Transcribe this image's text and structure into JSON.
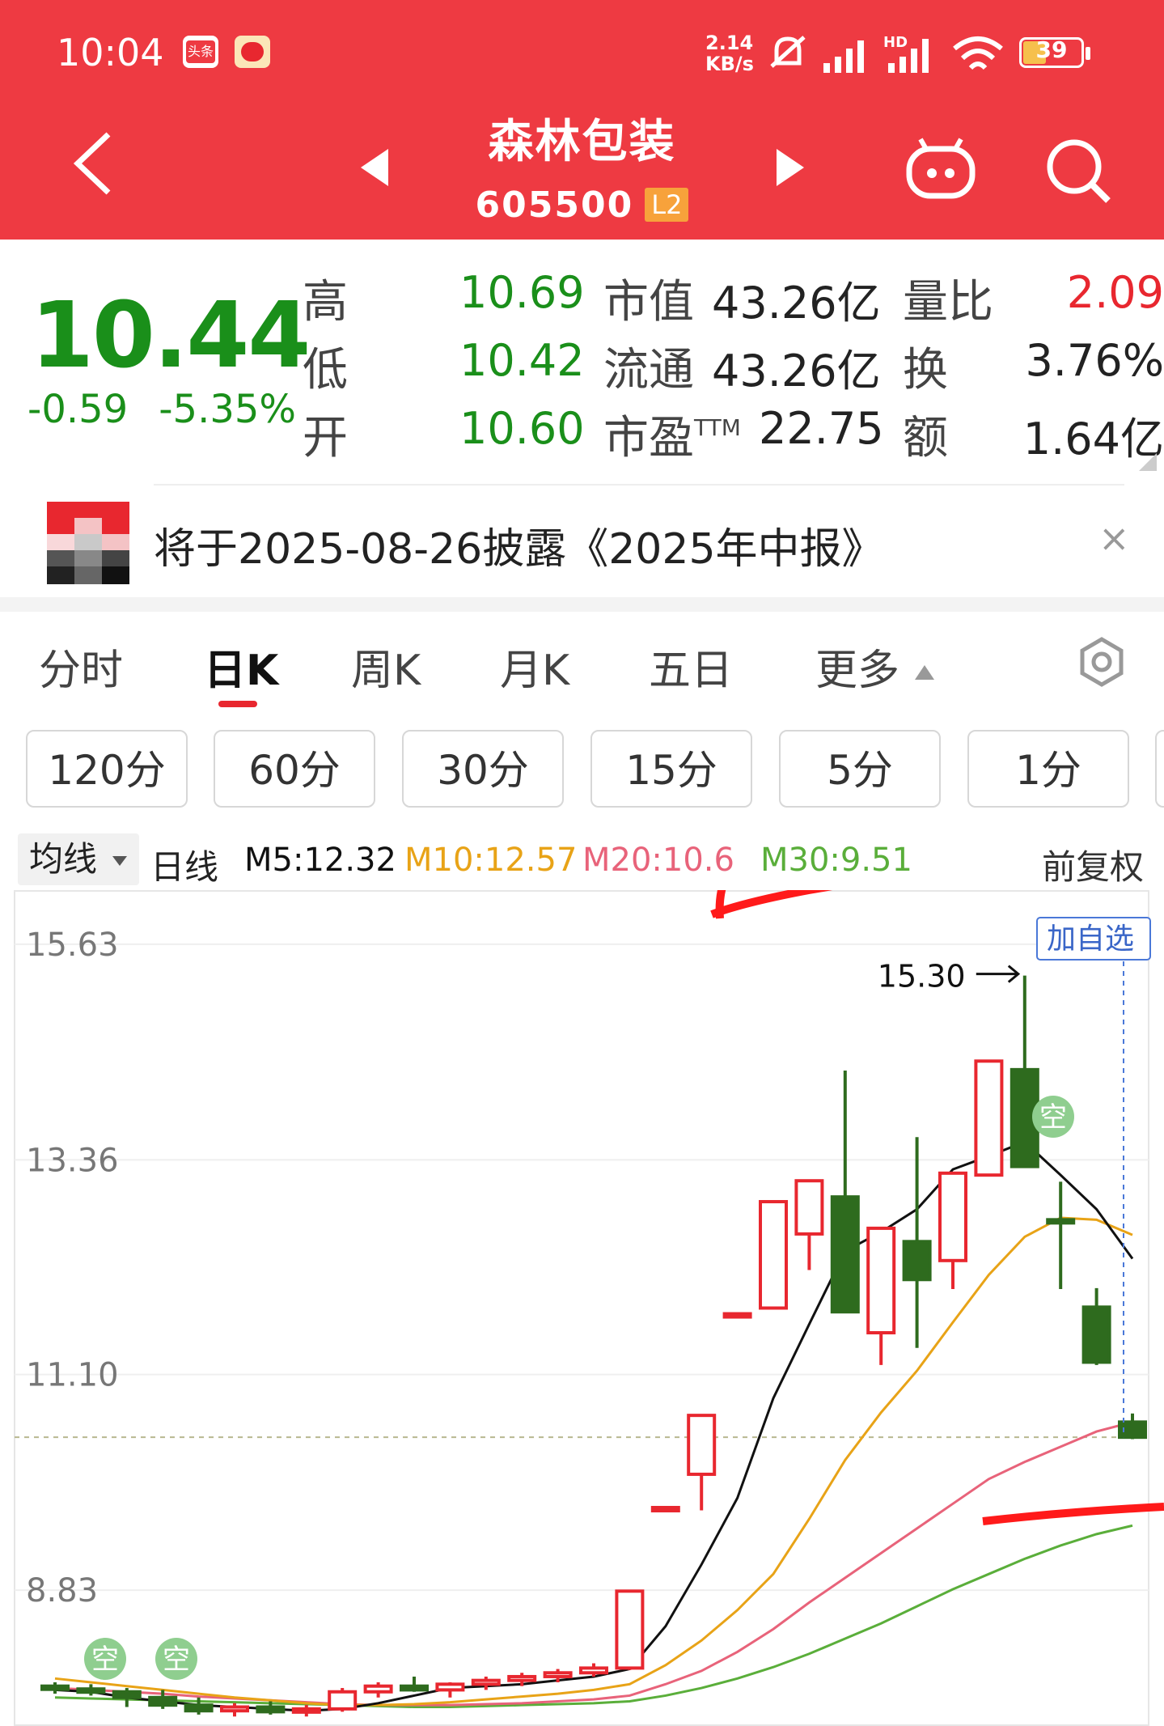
{
  "status_bar": {
    "time": "10:04",
    "net_speed": "2.14\nKB/s",
    "battery": "39",
    "icons": [
      "toutiao-app-icon",
      "red-app-icon",
      "mute-icon",
      "signal-icon",
      "hd-signal-icon",
      "wifi-icon",
      "battery-icon"
    ]
  },
  "header": {
    "title": "森林包装",
    "code": "605500",
    "level": "L2",
    "icons": [
      "back-icon",
      "prev-stock-icon",
      "next-stock-icon",
      "robot-icon",
      "search-icon"
    ]
  },
  "quote": {
    "price": "10.44",
    "change": "-0.59",
    "change_pct": "-5.35%",
    "fields": [
      {
        "label": "高",
        "value": "10.69"
      },
      {
        "label": "低",
        "value": "10.42"
      },
      {
        "label": "开",
        "value": "10.60"
      }
    ],
    "stats": [
      {
        "label": "市值",
        "sup": "",
        "value": "43.26亿"
      },
      {
        "label": "流通",
        "sup": "",
        "value": "43.26亿"
      },
      {
        "label": "市盈",
        "sup": "TTM",
        "value": "22.75"
      }
    ],
    "stats2": [
      {
        "label": "量比",
        "value": "2.09"
      },
      {
        "label": "换",
        "value": "3.76%"
      },
      {
        "label": "额",
        "value": "1.64亿"
      }
    ]
  },
  "announcement": {
    "text": "将于2025-08-26披露《2025年中报》",
    "close": "×"
  },
  "tabs": [
    "分时",
    "日K",
    "周K",
    "月K",
    "五日",
    "更多"
  ],
  "active_tab": "日K",
  "periods": [
    "120分",
    "60分",
    "30分",
    "15分",
    "5分",
    "1分"
  ],
  "ma_bar": {
    "selector": "均线",
    "period": "日线",
    "m5": "M5:12.32",
    "m10": "M10:12.57",
    "m20": "M20:10.6",
    "m30": "M30:9.51",
    "adjust": "前复权",
    "colors": {
      "m5": "#111111",
      "m10": "#e8a317",
      "m20": "#e8637a",
      "m30": "#5aae3a"
    }
  },
  "chart_data": {
    "type": "candlestick",
    "y_ticks": [
      "15.63",
      "13.36",
      "11.10",
      "8.83"
    ],
    "ylim": [
      7.4,
      16.2
    ],
    "high_annotation": "15.30",
    "current_price": 10.44,
    "add_watchlist": "加自选",
    "badges": [
      "空",
      "空",
      "空"
    ],
    "up_color": "#e8272f",
    "down_color": "#2e6b1e",
    "candles": [
      {
        "o": 7.82,
        "h": 7.86,
        "l": 7.74,
        "c": 7.79
      },
      {
        "o": 7.79,
        "h": 7.84,
        "l": 7.72,
        "c": 7.76
      },
      {
        "o": 7.76,
        "h": 7.8,
        "l": 7.6,
        "c": 7.7
      },
      {
        "o": 7.7,
        "h": 7.78,
        "l": 7.58,
        "c": 7.62
      },
      {
        "o": 7.62,
        "h": 7.7,
        "l": 7.52,
        "c": 7.56
      },
      {
        "o": 7.56,
        "h": 7.64,
        "l": 7.5,
        "c": 7.6
      },
      {
        "o": 7.6,
        "h": 7.66,
        "l": 7.52,
        "c": 7.55
      },
      {
        "o": 7.55,
        "h": 7.62,
        "l": 7.5,
        "c": 7.58
      },
      {
        "o": 7.58,
        "h": 7.8,
        "l": 7.55,
        "c": 7.76
      },
      {
        "o": 7.76,
        "h": 7.86,
        "l": 7.7,
        "c": 7.82
      },
      {
        "o": 7.82,
        "h": 7.92,
        "l": 7.76,
        "c": 7.78
      },
      {
        "o": 7.78,
        "h": 7.86,
        "l": 7.7,
        "c": 7.84
      },
      {
        "o": 7.84,
        "h": 7.92,
        "l": 7.78,
        "c": 7.88
      },
      {
        "o": 7.88,
        "h": 7.96,
        "l": 7.82,
        "c": 7.92
      },
      {
        "o": 7.92,
        "h": 8.0,
        "l": 7.86,
        "c": 7.96
      },
      {
        "o": 7.96,
        "h": 8.06,
        "l": 7.92,
        "c": 8.01
      },
      {
        "o": 8.01,
        "h": 8.82,
        "l": 7.99,
        "c": 8.82
      },
      {
        "o": 9.7,
        "h": 9.7,
        "l": 9.7,
        "c": 9.7
      },
      {
        "o": 10.05,
        "h": 10.67,
        "l": 9.67,
        "c": 10.67
      },
      {
        "o": 11.74,
        "h": 11.74,
        "l": 11.74,
        "c": 11.74
      },
      {
        "o": 11.8,
        "h": 12.92,
        "l": 11.8,
        "c": 12.92
      },
      {
        "o": 12.58,
        "h": 13.14,
        "l": 12.2,
        "c": 13.14
      },
      {
        "o": 12.97,
        "h": 14.3,
        "l": 11.76,
        "c": 11.76
      },
      {
        "o": 11.54,
        "h": 12.64,
        "l": 11.2,
        "c": 12.64
      },
      {
        "o": 12.5,
        "h": 13.6,
        "l": 11.38,
        "c": 12.1
      },
      {
        "o": 12.3,
        "h": 13.22,
        "l": 12.0,
        "c": 13.22
      },
      {
        "o": 13.2,
        "h": 14.4,
        "l": 13.2,
        "c": 14.4
      },
      {
        "o": 14.31,
        "h": 15.3,
        "l": 13.29,
        "c": 13.29
      },
      {
        "o": 12.73,
        "h": 13.13,
        "l": 12.0,
        "c": 12.7
      },
      {
        "o": 11.81,
        "h": 12.01,
        "l": 11.2,
        "c": 11.23
      },
      {
        "o": 10.6,
        "h": 10.69,
        "l": 10.42,
        "c": 10.44
      }
    ],
    "ma5": [
      7.78,
      7.76,
      7.7,
      7.66,
      7.62,
      7.6,
      7.58,
      7.56,
      7.58,
      7.64,
      7.72,
      7.8,
      7.82,
      7.84,
      7.88,
      7.92,
      8.0,
      8.45,
      9.1,
      9.8,
      10.85,
      11.63,
      12.4,
      12.6,
      12.84,
      13.26,
      13.4,
      13.55,
      13.2,
      12.84,
      12.32
    ],
    "ma10": [
      7.9,
      7.86,
      7.82,
      7.78,
      7.74,
      7.7,
      7.67,
      7.64,
      7.62,
      7.62,
      7.63,
      7.65,
      7.68,
      7.71,
      7.74,
      7.78,
      7.84,
      8.04,
      8.3,
      8.62,
      9.0,
      9.58,
      10.2,
      10.7,
      11.14,
      11.65,
      12.15,
      12.55,
      12.75,
      12.73,
      12.57
    ],
    "ma20": [
      7.8,
      7.78,
      7.76,
      7.74,
      7.71,
      7.69,
      7.67,
      7.65,
      7.63,
      7.62,
      7.62,
      7.62,
      7.63,
      7.64,
      7.66,
      7.68,
      7.72,
      7.84,
      7.98,
      8.18,
      8.42,
      8.7,
      8.96,
      9.22,
      9.48,
      9.74,
      10.0,
      10.18,
      10.34,
      10.5,
      10.6
    ],
    "ma30": [
      7.7,
      7.69,
      7.68,
      7.67,
      7.66,
      7.65,
      7.64,
      7.63,
      7.62,
      7.61,
      7.6,
      7.6,
      7.61,
      7.62,
      7.63,
      7.64,
      7.66,
      7.72,
      7.8,
      7.9,
      8.02,
      8.16,
      8.32,
      8.48,
      8.66,
      8.84,
      9.0,
      9.16,
      9.3,
      9.42,
      9.51
    ]
  }
}
